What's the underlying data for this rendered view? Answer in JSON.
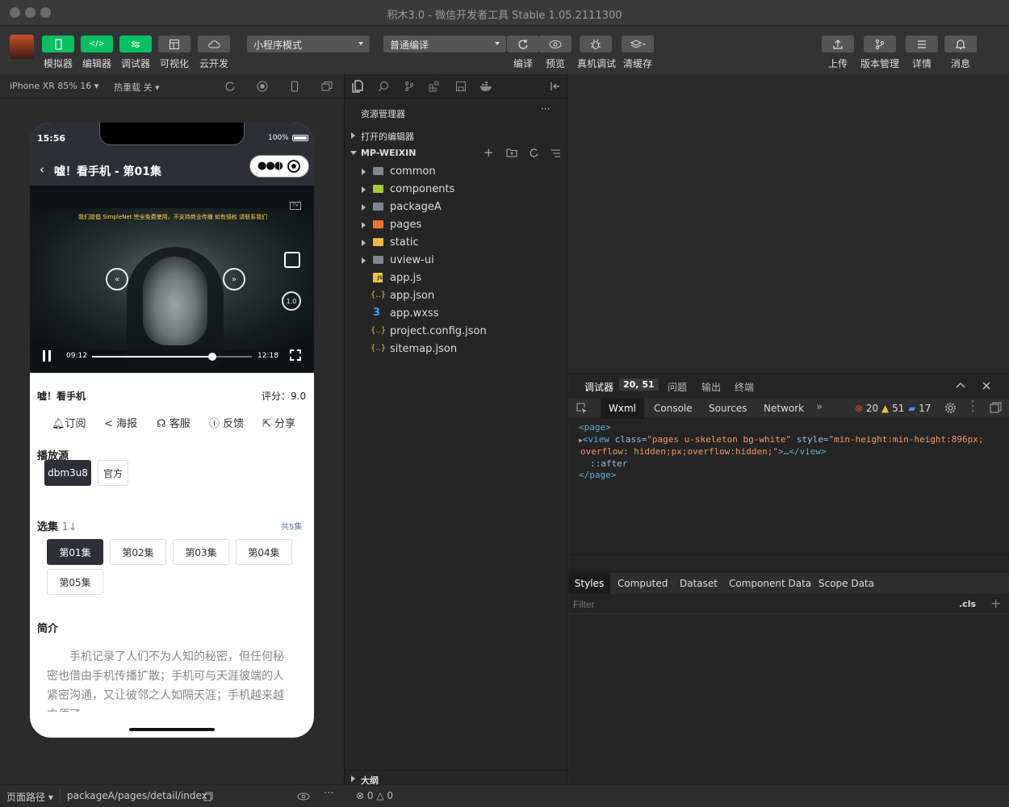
{
  "window": {
    "title": "积木3.0 - 微信开发者工具 Stable 1.05.2111300"
  },
  "toolbar": {
    "left_buttons": [
      {
        "label": "模拟器"
      },
      {
        "label": "编辑器"
      },
      {
        "label": "调试器"
      },
      {
        "label": "可视化"
      },
      {
        "label": "云开发"
      }
    ],
    "mode_select": "小程序模式",
    "compile_select": "普通编译",
    "mid_buttons": [
      {
        "label": "编译"
      },
      {
        "label": "预览"
      },
      {
        "label": "真机调试"
      },
      {
        "label": "清缓存"
      }
    ],
    "right_buttons": [
      {
        "label": "上传"
      },
      {
        "label": "版本管理"
      },
      {
        "label": "详情"
      },
      {
        "label": "消息"
      }
    ]
  },
  "simulator": {
    "device": "iPhone XR 85% 16",
    "hot_reload": "热重载 关",
    "phone": {
      "time": "15:56",
      "battery": "100%",
      "nav_title": "嘘！看手机 - 第01集",
      "video": {
        "subtitle": "我们提倡 SimpleNet 完全免费使用，不支持商业传播 如有侵权 请联系我们",
        "current_time": "09:12",
        "total_time": "12:18",
        "progress": 0.75,
        "speed": "1.0",
        "tv_label": "TV"
      },
      "show_title": "嘘！看手机",
      "rating": "评分：9.0",
      "actions": [
        "订阅",
        "海报",
        "客服",
        "反馈",
        "分享"
      ],
      "source_heading": "播放源",
      "sources": [
        "dbm3u8",
        "官方"
      ],
      "episode_heading": "选集",
      "episode_count": "共5集",
      "episodes": [
        "第01集",
        "第02集",
        "第03集",
        "第04集",
        "第05集"
      ],
      "intro_heading": "简介",
      "intro_text": "手机记录了人们不为人知的秘密，但任何秘密也借由手机传播扩散；手机可与天涯彼端的人紧密沟通，又让彼邻之人如隔天涯；手机越来越方便了"
    }
  },
  "explorer": {
    "title": "资源管理器",
    "open_editors": "打开的编辑器",
    "project": "MP-WEIXIN",
    "items": [
      {
        "name": "common",
        "type": "folder"
      },
      {
        "name": "components",
        "type": "folder"
      },
      {
        "name": "packageA",
        "type": "folder"
      },
      {
        "name": "pages",
        "type": "folder"
      },
      {
        "name": "static",
        "type": "folder"
      },
      {
        "name": "uview-ui",
        "type": "folder"
      },
      {
        "name": "app.js",
        "type": "js"
      },
      {
        "name": "app.json",
        "type": "json"
      },
      {
        "name": "app.wxss",
        "type": "css"
      },
      {
        "name": "project.config.json",
        "type": "json"
      },
      {
        "name": "sitemap.json",
        "type": "json"
      }
    ],
    "outline": "大纲"
  },
  "debugger": {
    "tabs": [
      "调试器",
      "问题",
      "输出",
      "终端"
    ],
    "badge": "20, 51",
    "subtabs": [
      "Wxml",
      "Console",
      "Sources",
      "Network"
    ],
    "errors": "20",
    "warnings": "51",
    "infos": "17",
    "code": {
      "line1": "<page>",
      "line2_tag": "<view",
      "line2_attr1": " class=",
      "line2_val1": "\"pages u-skeleton bg-white\"",
      "line2_attr2": " style=",
      "line2_val2": "\"min-height:min-height:896px;",
      "line3_val": "overflow: hidden;px;overflow:hidden;\"",
      "line3_end": ">…</view>",
      "line4": "::after",
      "line5": "</page>"
    },
    "style_tabs": [
      "Styles",
      "Computed",
      "Dataset",
      "Component Data",
      "Scope Data"
    ],
    "filter_placeholder": "Filter",
    "cls": ".cls"
  },
  "statusbar": {
    "page_path_label": "页面路径",
    "page_path": "packageA/pages/detail/index",
    "errors": "0",
    "warnings": "0"
  }
}
